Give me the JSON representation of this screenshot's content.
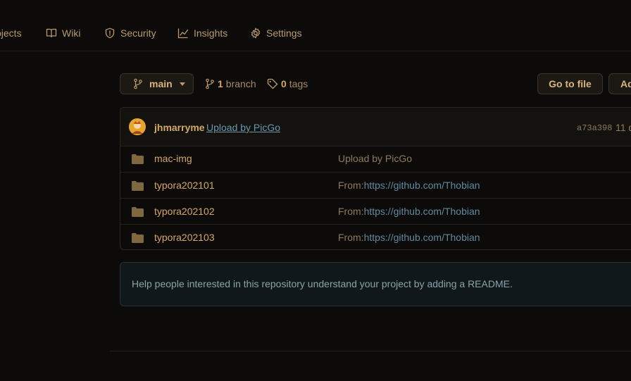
{
  "nav": {
    "items": [
      {
        "label": "ojects",
        "icon": "projects-icon"
      },
      {
        "label": "Wiki",
        "icon": "book-icon"
      },
      {
        "label": "Security",
        "icon": "shield-icon"
      },
      {
        "label": "Insights",
        "icon": "graph-icon"
      },
      {
        "label": "Settings",
        "icon": "gear-icon"
      }
    ]
  },
  "controls": {
    "branch_button": "main",
    "branch_count": "1",
    "branch_word": "branch",
    "tags_count": "0",
    "tags_word": "tags",
    "go_to_file": "Go to file",
    "add_file": "Ad"
  },
  "commit": {
    "author": "jhmarryme",
    "message": "Upload by PicGo",
    "hash": "a73a398",
    "time": "11 d"
  },
  "files": [
    {
      "name": "mac-img",
      "msg_prefix": "Upload by PicGo",
      "msg_link": ""
    },
    {
      "name": "typora202101",
      "msg_prefix": "From:",
      "msg_link": "https://github.com/Thobian"
    },
    {
      "name": "typora202102",
      "msg_prefix": "From:",
      "msg_link": "https://github.com/Thobian"
    },
    {
      "name": "typora202103",
      "msg_prefix": "From:",
      "msg_link": "https://github.com/Thobian"
    }
  ],
  "readme_hint": "Help people interested in this repository understand your project by adding a README.",
  "colors": {
    "background": "#0c0b09",
    "accent": "#d4a866",
    "link": "#5f8aa0"
  }
}
